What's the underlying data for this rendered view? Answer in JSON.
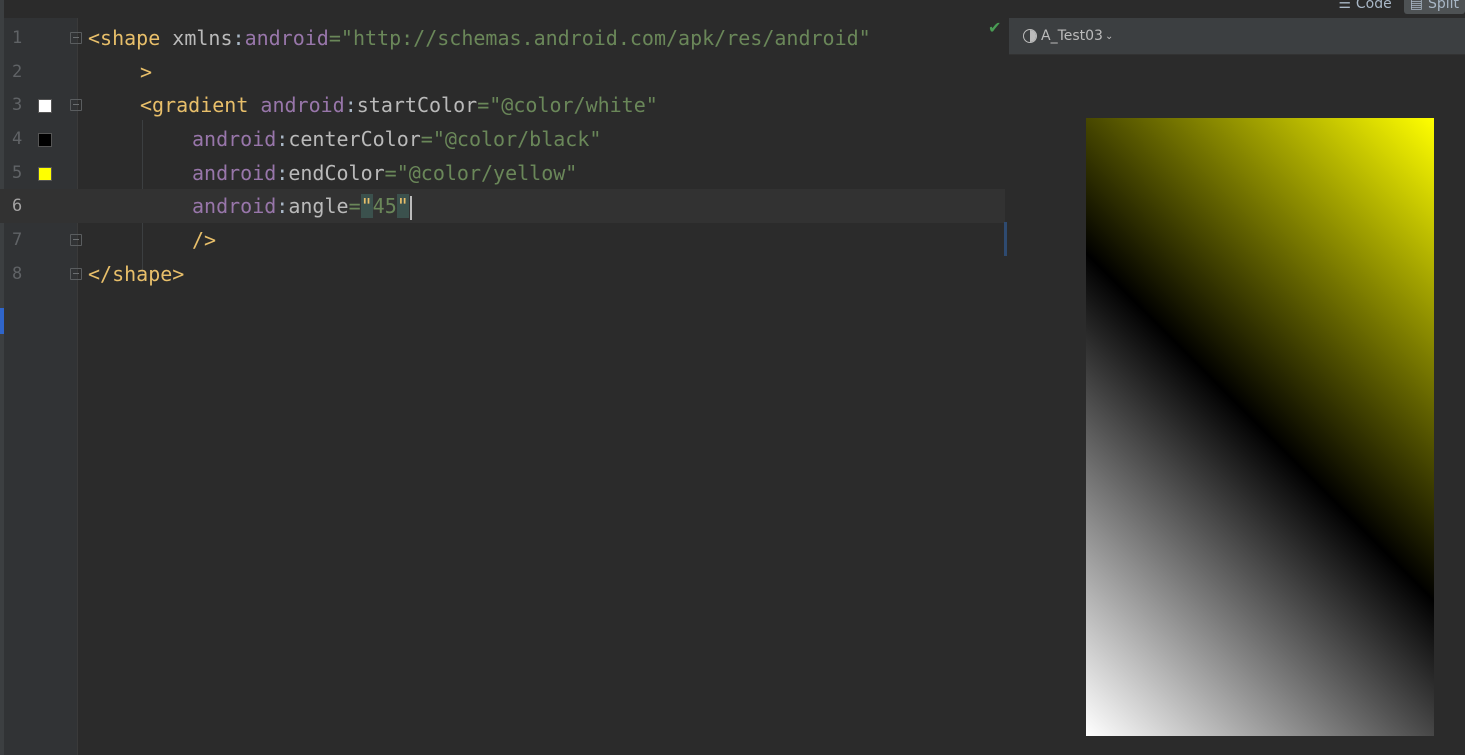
{
  "toolbar": {
    "code_label": "Code",
    "split_label": "Split"
  },
  "preview": {
    "theme_label": "A_Test03",
    "gradient": {
      "start_color": "#ffffff",
      "center_color": "#000000",
      "end_color": "#ffff00",
      "angle": 45
    }
  },
  "editor": {
    "current_line": 6,
    "lines": [
      {
        "number": "1"
      },
      {
        "number": "2"
      },
      {
        "number": "3"
      },
      {
        "number": "4"
      },
      {
        "number": "5"
      },
      {
        "number": "6"
      },
      {
        "number": "7"
      },
      {
        "number": "8"
      }
    ],
    "tokens": {
      "l1_tag_open": "<shape",
      "l1_attr_ns": "xmlns",
      "l1_colon": ":",
      "l1_attr": "android",
      "l1_eq": "=",
      "l1_val": "\"http://schemas.android.com/apk/res/android\"",
      "l2_close": ">",
      "l3_tag_open": "<gradient",
      "l3_attr_ns": "android",
      "l3_colon": ":",
      "l3_attr": "startColor",
      "l3_eq": "=",
      "l3_val": "\"@color/white\"",
      "l4_attr_ns": "android",
      "l4_colon": ":",
      "l4_attr": "centerColor",
      "l4_eq": "=",
      "l4_val": "\"@color/black\"",
      "l5_attr_ns": "android",
      "l5_colon": ":",
      "l5_attr": "endColor",
      "l5_eq": "=",
      "l5_val": "\"@color/yellow\"",
      "l6_attr_ns": "android",
      "l6_colon": ":",
      "l6_attr": "angle",
      "l6_eq": "=",
      "l6_quote_open": "\"",
      "l6_val": "45",
      "l6_quote_close": "\"",
      "l7_close": "/>",
      "l8_tag_close": "</shape>"
    },
    "swatches": {
      "line3": "#ffffff",
      "line4": "#000000",
      "line5": "#ffff00"
    }
  }
}
